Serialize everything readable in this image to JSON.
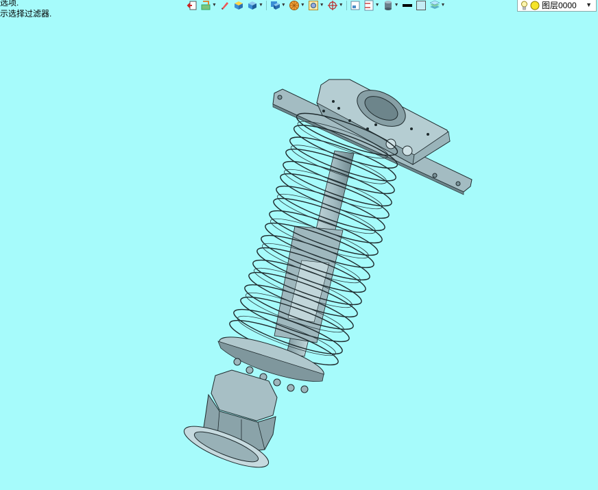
{
  "status": {
    "line1": "选项.",
    "line2": "示选择过滤器."
  },
  "toolbar": {
    "items": [
      {
        "icon": "exit-sketch-icon",
        "dropdown": false
      },
      {
        "icon": "sketch-tools-icon",
        "dropdown": true
      },
      {
        "icon": "pencil-icon",
        "dropdown": false
      },
      {
        "icon": "solid-box-icon",
        "dropdown": false
      },
      {
        "icon": "box-view-icon",
        "dropdown": true
      },
      {
        "icon": "display-mode-icon",
        "dropdown": true
      },
      {
        "icon": "orange-sphere-icon",
        "dropdown": true
      },
      {
        "icon": "zoom-window-icon",
        "dropdown": true
      },
      {
        "icon": "crosshair-icon",
        "dropdown": true
      },
      {
        "icon": "grid-icon",
        "dropdown": false
      },
      {
        "icon": "ruler-icon",
        "dropdown": true
      },
      {
        "icon": "cylinder-icon",
        "dropdown": true
      },
      {
        "icon": "line-color-icon",
        "dropdown": false
      },
      {
        "icon": "fill-color-icon",
        "dropdown": false
      },
      {
        "icon": "layer-stack-icon",
        "dropdown": true
      }
    ]
  },
  "layer": {
    "bulb_icon": "lightbulb-icon",
    "dot_icon": "yellow-dot-icon",
    "current": "图层0000"
  },
  "colors": {
    "background": "#a6fbfb",
    "metal": "#a9c4c9",
    "metal_dark": "#5d7479",
    "outline": "#1e2a2d"
  }
}
